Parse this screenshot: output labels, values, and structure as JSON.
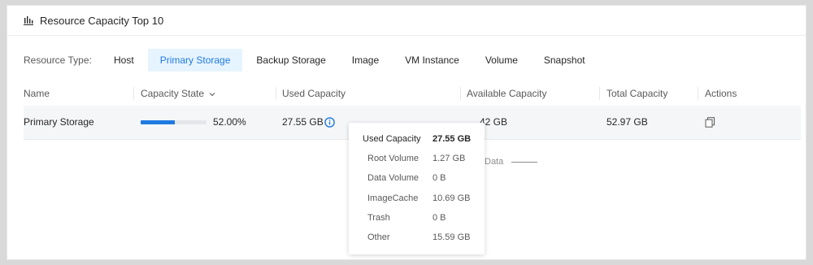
{
  "panel": {
    "title": "Resource Capacity Top 10",
    "icon": "bar-chart-icon"
  },
  "resource_type": {
    "label": "Resource Type:",
    "tabs": [
      {
        "label": "Host",
        "active": false
      },
      {
        "label": "Primary Storage",
        "active": true
      },
      {
        "label": "Backup Storage",
        "active": false
      },
      {
        "label": "Image",
        "active": false
      },
      {
        "label": "VM Instance",
        "active": false
      },
      {
        "label": "Volume",
        "active": false
      },
      {
        "label": "Snapshot",
        "active": false
      }
    ]
  },
  "table": {
    "columns": {
      "name": "Name",
      "capacity_state": "Capacity State",
      "used_capacity": "Used Capacity",
      "available_capacity": "Available Capacity",
      "total_capacity": "Total Capacity",
      "actions": "Actions"
    },
    "rows": [
      {
        "name": "Primary Storage",
        "capacity_percent_text": "52.00%",
        "capacity_fraction": 0.52,
        "used": "27.55 GB",
        "available": "42 GB",
        "total": "52.97 GB"
      }
    ]
  },
  "legend_hint": "Data",
  "tooltip": {
    "header": {
      "key": "Used Capacity",
      "value": "27.55 GB"
    },
    "items": [
      {
        "key": "Root Volume",
        "value": "1.27 GB"
      },
      {
        "key": "Data Volume",
        "value": "0 B"
      },
      {
        "key": "ImageCache",
        "value": "10.69 GB"
      },
      {
        "key": "Trash",
        "value": "0 B"
      },
      {
        "key": "Other",
        "value": "15.59 GB"
      }
    ]
  },
  "colors": {
    "accent": "#1f7ae0",
    "active_tab_bg": "#e6f4ff",
    "row_bg": "#f5f6f8"
  }
}
